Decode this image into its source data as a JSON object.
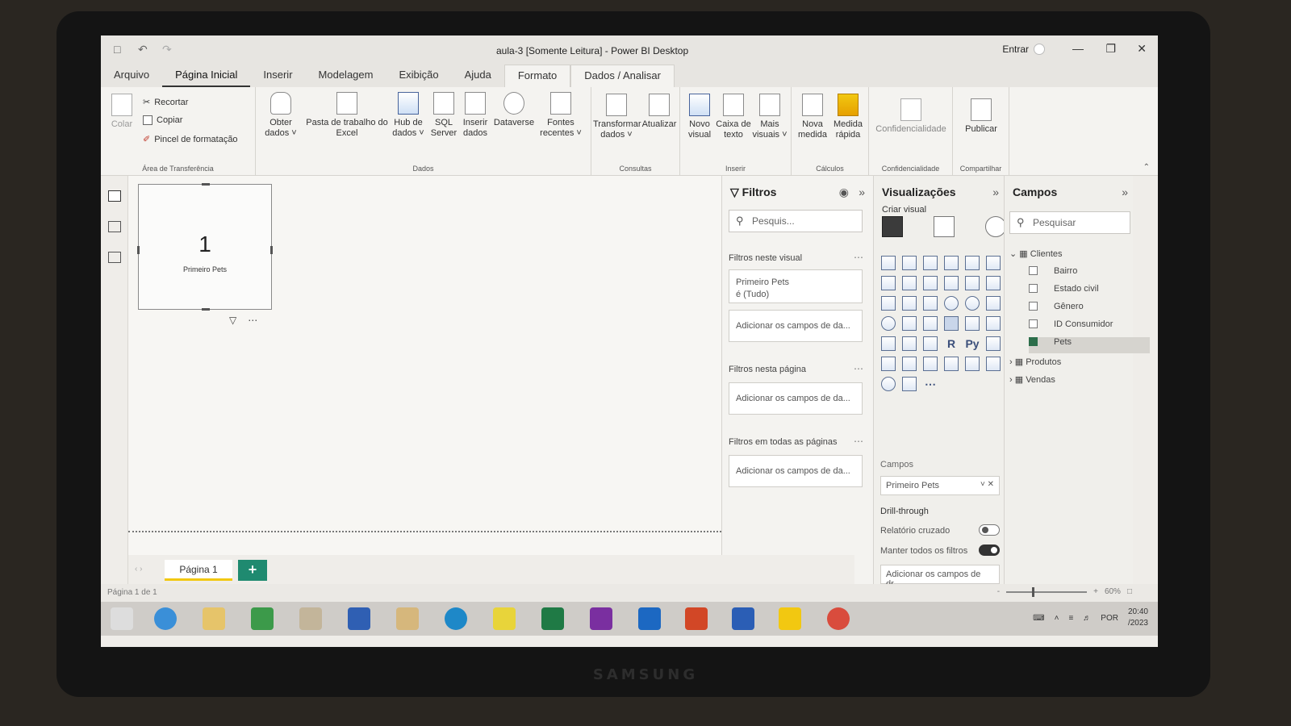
{
  "window": {
    "title": "aula-3 [Somente Leitura] - Power BI Desktop",
    "signin": "Entrar"
  },
  "tabs": [
    "Arquivo",
    "Página Inicial",
    "Inserir",
    "Modelagem",
    "Exibição",
    "Ajuda",
    "Formato",
    "Dados / Analisar"
  ],
  "ribbon": {
    "clipboard": {
      "paste": "Colar",
      "cut": "Recortar",
      "copy": "Copiar",
      "format_painter": "Pincel de formatação",
      "group": "Área de Transferência"
    },
    "data": {
      "get_data": "Obter dados",
      "excel": "Pasta de trabalho do Excel",
      "data_hub": "Hub de dados",
      "sql": "SQL Server",
      "enter_data": "Inserir dados",
      "dataverse": "Dataverse",
      "recent": "Fontes recentes",
      "group": "Dados"
    },
    "queries": {
      "transform": "Transformar dados",
      "refresh": "Atualizar",
      "group": "Consultas"
    },
    "insert": {
      "new_visual": "Novo visual",
      "text_box": "Caixa de texto",
      "more_visuals": "Mais visuais",
      "group": "Inserir"
    },
    "calc": {
      "new_measure": "Nova medida",
      "quick_measure": "Medida rápida",
      "group": "Cálculos"
    },
    "sensitivity": {
      "label": "Confidencialidade",
      "group": "Confidencialidade"
    },
    "share": {
      "publish": "Publicar",
      "group": "Compartilhar"
    }
  },
  "canvas": {
    "card_value": "1",
    "card_label": "Primeiro Pets"
  },
  "filters": {
    "title": "Filtros",
    "search_placeholder": "Pesquis...",
    "this_visual": "Filtros neste visual",
    "visual_filter_field": "Primeiro Pets",
    "visual_filter_value": "é (Tudo)",
    "add_fields_visual": "Adicionar os campos de da...",
    "this_page": "Filtros nesta página",
    "add_fields_page": "Adicionar os campos de da...",
    "all_pages": "Filtros em todas as páginas",
    "add_fields_all": "Adicionar os campos de da..."
  },
  "visualizations": {
    "title": "Visualizações",
    "build": "Criar visual",
    "fields_label": "Campos",
    "field_value": "Primeiro Pets",
    "drillthrough": "Drill-through",
    "cross_report": "Relatório cruzado",
    "keep_filters": "Manter todos os filtros",
    "add_drill": "Adicionar os campos de dr..."
  },
  "fields": {
    "title": "Campos",
    "search_placeholder": "Pesquisar",
    "tables": [
      {
        "name": "Clientes",
        "expanded": true,
        "fields": [
          {
            "name": "Bairro",
            "checked": false
          },
          {
            "name": "Estado civil",
            "checked": false
          },
          {
            "name": "Gênero",
            "checked": false
          },
          {
            "name": "ID Consumidor",
            "checked": false
          },
          {
            "name": "Pets",
            "checked": true
          }
        ]
      },
      {
        "name": "Produtos",
        "expanded": false
      },
      {
        "name": "Vendas",
        "expanded": false
      }
    ]
  },
  "pages": {
    "tab": "Página 1",
    "add": "+",
    "status": "Página 1 de 1",
    "zoom": "60%"
  },
  "taskbar": {
    "lang": "POR",
    "time": "20:40",
    "date": "/2023"
  }
}
